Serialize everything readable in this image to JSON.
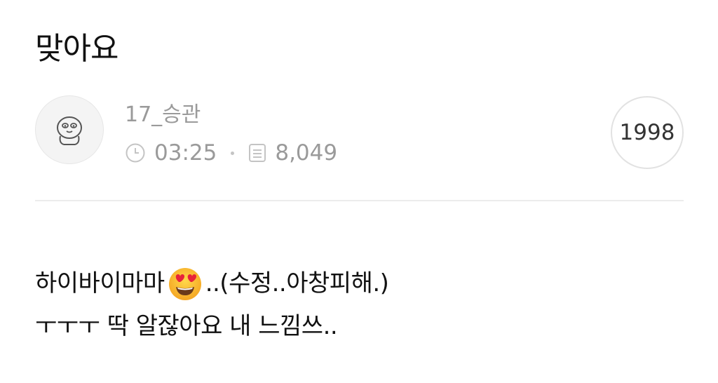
{
  "post": {
    "title": "맞아요",
    "author": "17_승관",
    "time": "03:25",
    "views": "8,049",
    "badge": "1998",
    "body_line1_a": "하이바이마마",
    "body_line1_b": "..(수정..아창피해.)",
    "body_line2": "ㅜㅜㅜ 딱 알잖아요 내 느낌쓰.."
  },
  "icons": {
    "avatar": "character-avatar-icon",
    "time": "clock-icon",
    "views": "document-icon",
    "emoji": "heart-eyes-emoji"
  }
}
